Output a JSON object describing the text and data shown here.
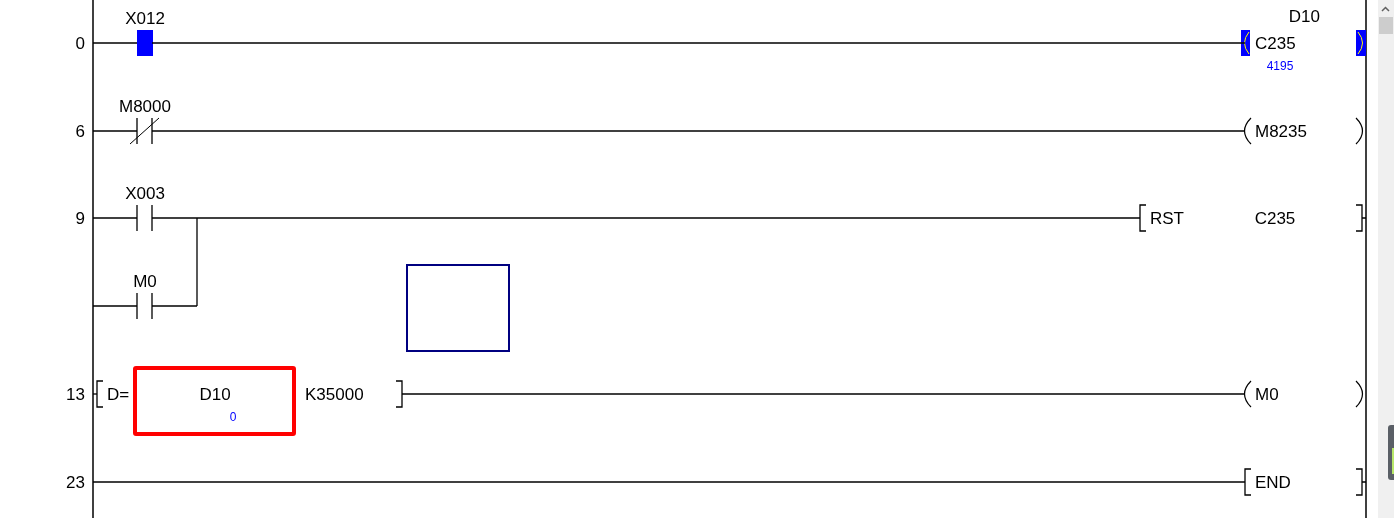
{
  "rungs": [
    {
      "step": "0",
      "contacts": [
        {
          "kind": "no",
          "label": "X012",
          "active": true
        }
      ],
      "output": {
        "kind": "coil",
        "operand_top": "D10",
        "operand": "C235",
        "value": "4195",
        "active": true
      }
    },
    {
      "step": "6",
      "contacts": [
        {
          "kind": "nc",
          "label": "M8000",
          "active": false
        }
      ],
      "output": {
        "kind": "coil",
        "operand": "M8235",
        "active": false
      }
    },
    {
      "step": "9",
      "contacts": [
        {
          "kind": "no",
          "label": "X003",
          "active": false
        }
      ],
      "branch": [
        {
          "kind": "no",
          "label": "M0",
          "active": false
        }
      ],
      "output": {
        "kind": "instruction",
        "instruction": "RST",
        "operand": "C235"
      }
    },
    {
      "step": "13",
      "compare": {
        "op": "D=",
        "operand1": "D10",
        "value1": "0",
        "operand1_selected": true,
        "operand2": "K35000"
      },
      "output": {
        "kind": "coil",
        "operand": "M0",
        "active": false
      }
    },
    {
      "step": "23",
      "output": {
        "kind": "instruction",
        "instruction": "END"
      }
    }
  ]
}
